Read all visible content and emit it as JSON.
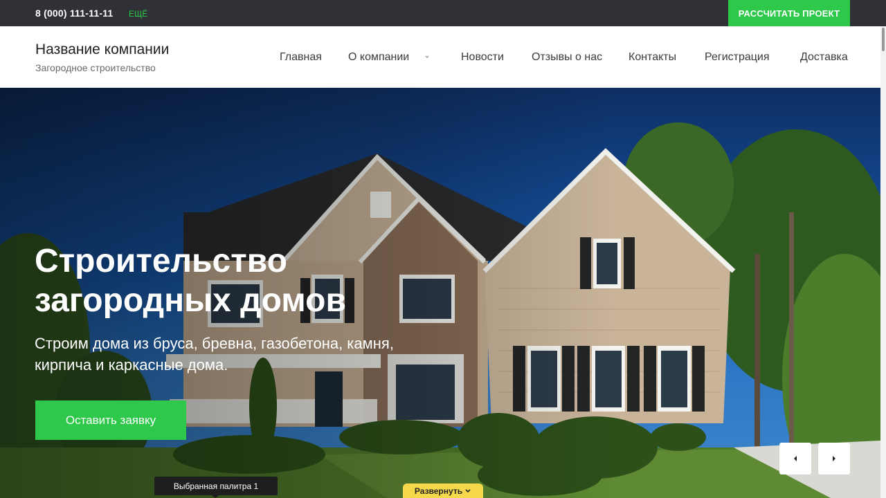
{
  "topbar": {
    "phone": "8 (000) 111-11-11",
    "more_label": "ЕЩЁ",
    "cta_label": "РАССЧИТАТЬ ПРОЕКТ"
  },
  "header": {
    "company_name": "Название компании",
    "tagline": "Загородное строительство",
    "nav": [
      {
        "label": "Главная"
      },
      {
        "label": "О компании"
      },
      {
        "label": "Новости"
      },
      {
        "label": "Отзывы о нас"
      },
      {
        "label": "Контакты"
      },
      {
        "label": "Регистрация"
      },
      {
        "label": "Доставка"
      }
    ]
  },
  "hero": {
    "title": "Строительство загородных домов",
    "subtitle": "Строим дома из бруса, бревна, газобетона, камня, кирпича и каркасные дома.",
    "button_label": "Оставить заявку",
    "prev_icon": "chevron-left-icon",
    "next_icon": "chevron-right-icon"
  },
  "widgets": {
    "palette_label": "Выбранная палитра 1",
    "expand_label": "Развернуть"
  },
  "colors": {
    "accent": "#2ec84a",
    "topbar_bg": "#2f3136",
    "expand_tab": "#f5d94a"
  }
}
